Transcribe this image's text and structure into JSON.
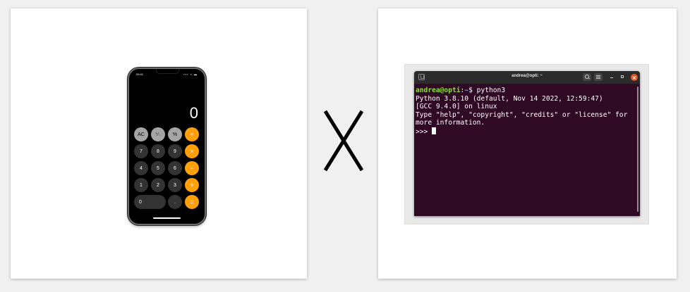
{
  "phone": {
    "status_time": "09:41",
    "status_icons": "▪▪▪ ≈ ▬",
    "display": "0",
    "keys": [
      [
        "AC",
        "⁺∕₋",
        "%",
        "÷"
      ],
      [
        "7",
        "8",
        "9",
        "×"
      ],
      [
        "4",
        "5",
        "6",
        "−"
      ],
      [
        "1",
        "2",
        "3",
        "+"
      ],
      [
        "0",
        ".",
        "="
      ]
    ]
  },
  "separator": {
    "symbol": "X"
  },
  "terminal": {
    "title": "andrea@opti: ~",
    "prompt_user": "andrea@opti",
    "prompt_sep": ":",
    "prompt_path": "~",
    "prompt_char": "$ ",
    "command": "python3",
    "output_lines": [
      "Python 3.8.10 (default, Nov 14 2022, 12:59:47)",
      "[GCC 9.4.0] on linux",
      "Type \"help\", \"copyright\", \"credits\" or \"license\" for",
      "more information."
    ],
    "repl_prompt": ">>> "
  },
  "colors": {
    "terminal_bg": "#300a24",
    "prompt_user": "#8ae234",
    "prompt_path": "#729fcf",
    "operator_key": "#ff9f0a",
    "function_key": "#a5a5a5",
    "digit_key": "#333333",
    "close_button": "#e95420"
  }
}
